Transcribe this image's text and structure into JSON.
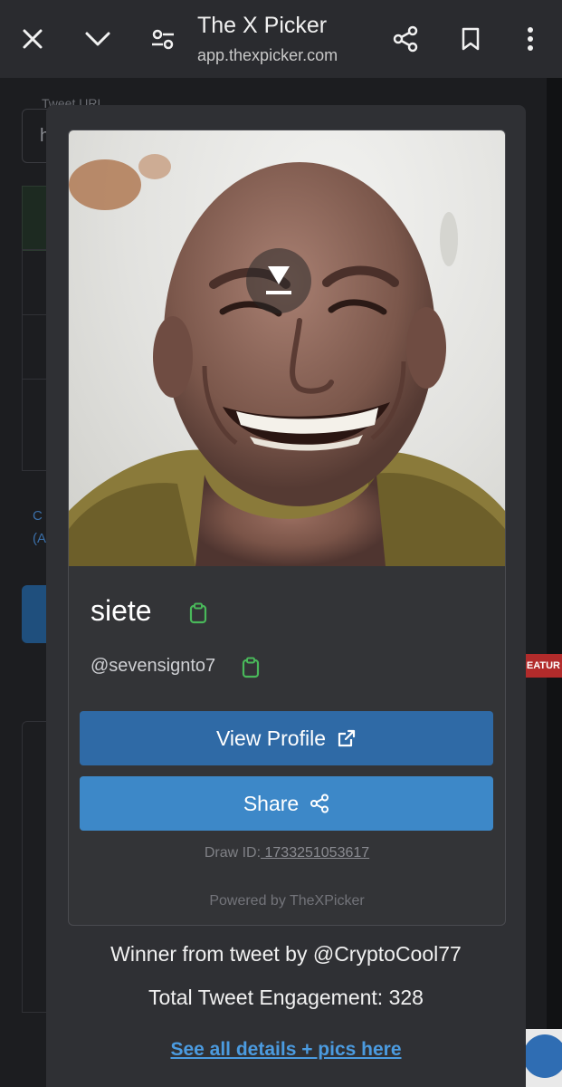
{
  "browser": {
    "title": "The X Picker",
    "url": "app.thexpicker.com"
  },
  "background": {
    "field_label": "Tweet URL",
    "field_letter": "h",
    "link_line1": "C",
    "link_line2": "(A",
    "badge": "EATUR"
  },
  "winner_card": {
    "name": "siete",
    "handle": "@sevensignto7",
    "view_profile_label": "View Profile",
    "share_label": "Share",
    "draw_id_label": "Draw ID:",
    "draw_id_value": " 1733251053617",
    "powered_by": "Powered by TheXPicker"
  },
  "summary": {
    "winner_from": "Winner from tweet by @CryptoCool77",
    "engagement": "Total Tweet Engagement: 328",
    "details_link": "See all details + pics here"
  },
  "colors": {
    "primary_button": "#2f6aa6",
    "share_button": "#3d88c8",
    "link": "#4b9be0",
    "clipboard_icon": "#49b85a"
  },
  "icons": [
    "close-icon",
    "chevron-down-icon",
    "page-settings-icon",
    "share-icon",
    "bookmark-icon",
    "more-vert-icon",
    "download-icon",
    "clipboard-icon",
    "external-link-icon"
  ]
}
